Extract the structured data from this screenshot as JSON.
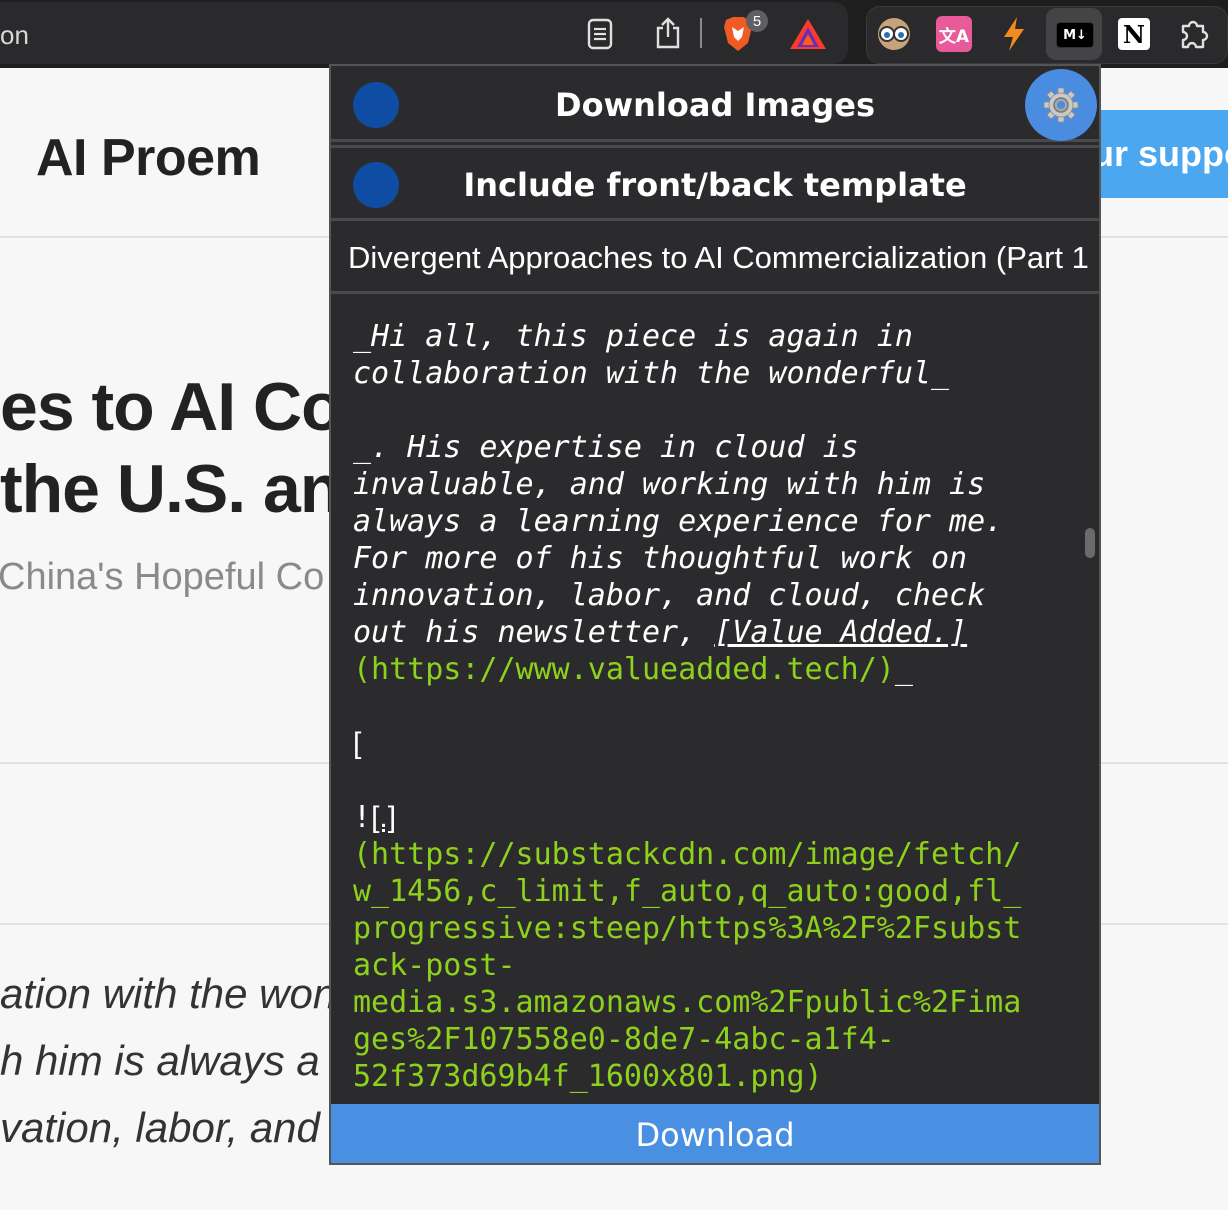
{
  "browser": {
    "url_fragment": "on",
    "brave_badge": "5",
    "extensions": {
      "translate_label": "文A",
      "markdown_label": "M↓",
      "notion_label": "N"
    },
    "icons": [
      "reader-mode-icon",
      "share-icon",
      "brave-shields-icon",
      "brave-rewards-icon",
      "eyes-extension-icon",
      "translate-extension-icon",
      "bolt-extension-icon",
      "markdown-extension-icon",
      "notion-extension-icon",
      "extensions-puzzle-icon"
    ]
  },
  "page": {
    "site_title": "AI Proem",
    "support_button": "ur suppo",
    "headline_line1": "es to AI Co",
    "headline_line2": "the U.S. an",
    "subtitle": "China's Hopeful Co",
    "body_line1": "ation with the won",
    "body_line2": "h him is always a l",
    "body_line3": "vation, labor, and"
  },
  "popup": {
    "download_images_label": "Download Images",
    "include_template_label": "Include front/back template",
    "title_value": "Divergent Approaches to AI Commercialization (Part 1",
    "markdown": {
      "l1": "_Hi all, this piece is again in",
      "l2": "collaboration with the wonderful_",
      "l3": "_. His expertise in cloud is",
      "l4": "invaluable, and working with him is",
      "l5": "always a learning experience for me.",
      "l6": "For more of his thoughtful work on",
      "l7": "innovation, labor, and cloud, check",
      "l8a": "out his newsletter, ",
      "l8b": "[Value Added.]",
      "l9": "(https://www.valueadded.tech/)",
      "l9end": "_",
      "l10": "[",
      "l11a": "!",
      "l11b": "[.]",
      "l12": "(https://substackcdn.com/image/fetch/",
      "l13": "w_1456,c_limit,f_auto,q_auto:good,fl_",
      "l14": "progressive:steep/https%3A%2F%2Fsubst",
      "l15": "ack-post-",
      "l16": "media.s3.amazonaws.com%2Fpublic%2Fima",
      "l17": "ges%2F107558e0-8de7-4abc-a1f4-",
      "l18": "52f373d69b4f_1600x801.png)"
    },
    "download_button": "Download",
    "colors": {
      "accent": "#4a90e2",
      "toggle": "#0f4da4",
      "code_green": "#8ed11c",
      "popup_bg": "#2b2b2e"
    }
  }
}
